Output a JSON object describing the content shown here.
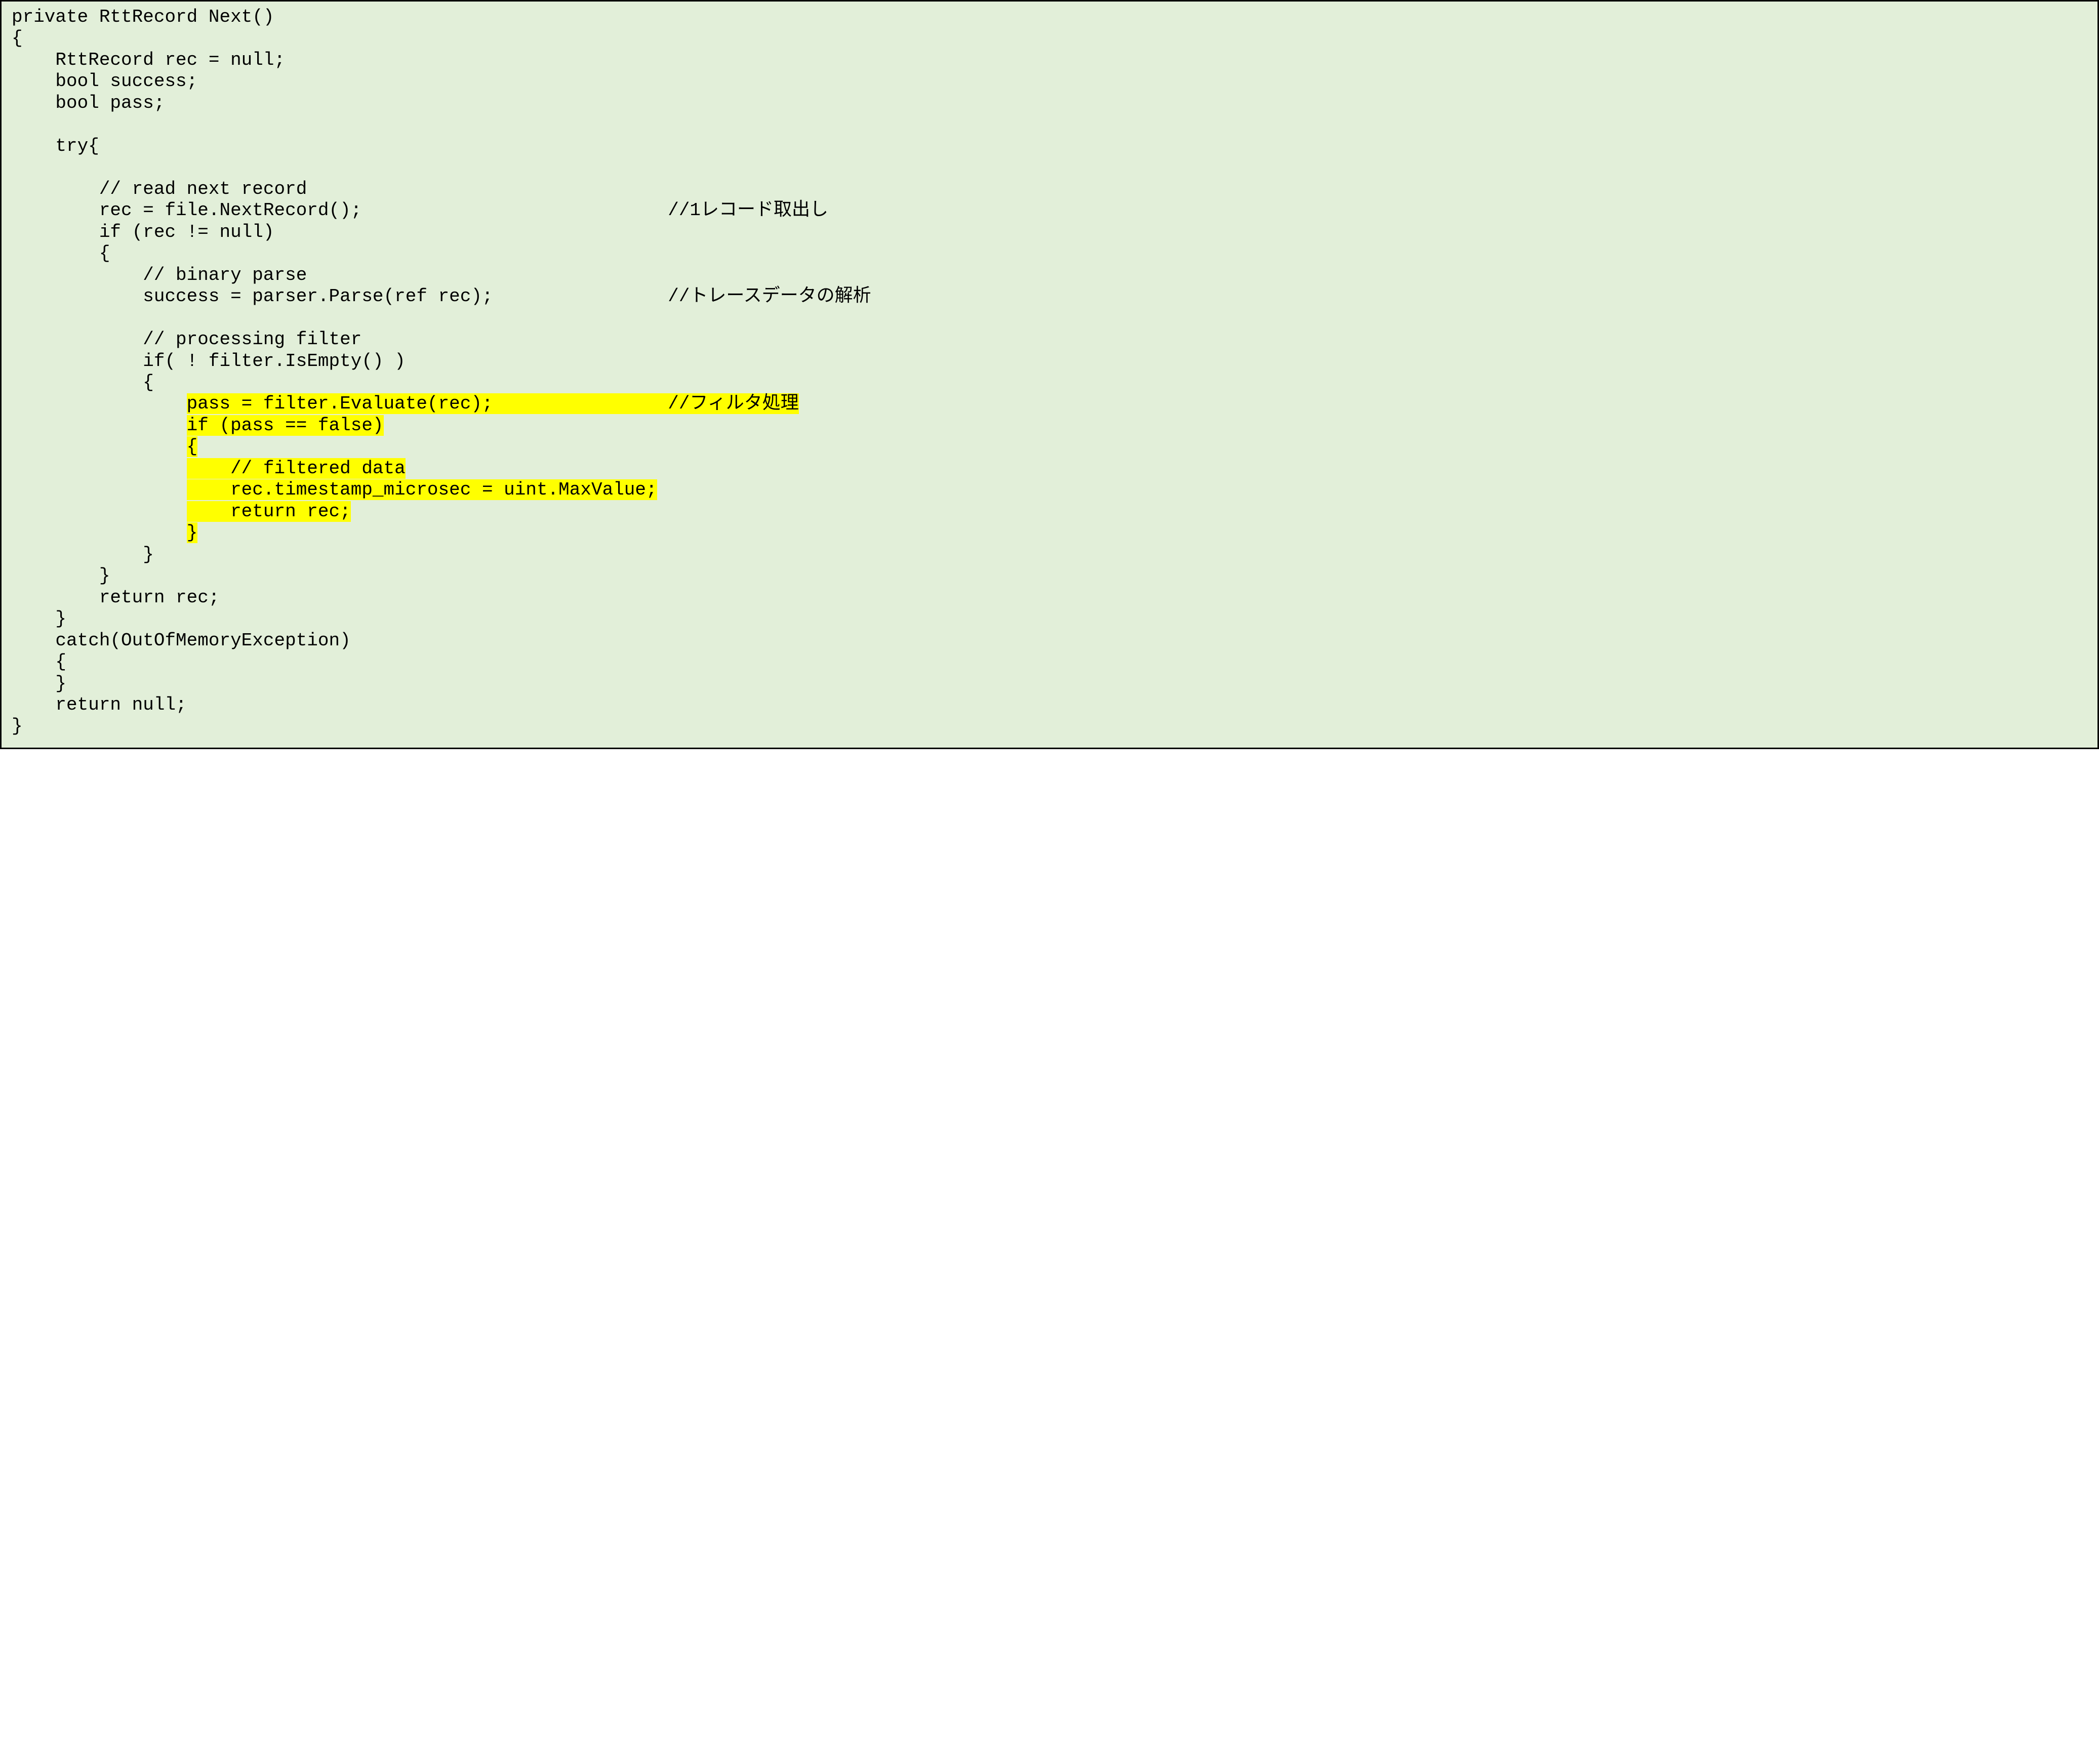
{
  "code": {
    "l01": "private RttRecord Next()",
    "l02": "{",
    "l03": "    RttRecord rec = null;",
    "l04": "    bool success;",
    "l05": "    bool pass;",
    "l06": "",
    "l07": "    try{",
    "l08": "",
    "l09": "        // read next record",
    "l10a": "        rec = file.NextRecord();                            ",
    "l10b": "//1レコード取出し",
    "l11": "        if (rec != null)",
    "l12": "        {",
    "l13": "            // binary parse",
    "l14a": "            success = parser.Parse(ref rec);                ",
    "l14b": "//トレースデータの解析",
    "l15": "",
    "l16": "            // processing filter",
    "l17": "            if( ! filter.IsEmpty() )",
    "l18": "            {",
    "l19pad": "                ",
    "l19a": "pass = filter.Evaluate(rec);                ",
    "l19b": "//フィルタ処理",
    "l20pad": "                ",
    "l20": "if (pass == false)",
    "l21pad": "                ",
    "l21": "{",
    "l22pad": "                ",
    "l22": "    // filtered data",
    "l23pad": "                ",
    "l23": "    rec.timestamp_microsec = uint.MaxValue;",
    "l24pad": "                ",
    "l24": "    return rec;",
    "l25pad": "                ",
    "l25": "}",
    "l26": "            }",
    "l27": "        }",
    "l28": "        return rec;",
    "l29": "    }",
    "l30": "    catch(OutOfMemoryException)",
    "l31": "    {",
    "l32": "    }",
    "l33": "    return null;",
    "l34": "}"
  }
}
